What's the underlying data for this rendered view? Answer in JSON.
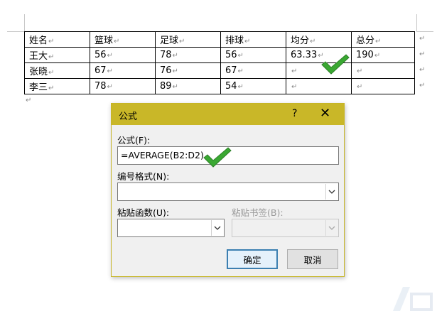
{
  "table": {
    "header": [
      "姓名",
      "篮球",
      "足球",
      "排球",
      "均分",
      "总分"
    ],
    "rows": [
      [
        "王大",
        "56",
        "78",
        "56",
        "63.33",
        "190"
      ],
      [
        "张晓",
        "67",
        "76",
        "67",
        "",
        ""
      ],
      [
        "李三",
        "78",
        "89",
        "54",
        "",
        ""
      ]
    ],
    "cell_mark": "↵"
  },
  "dialog": {
    "title": "公式",
    "help": "?",
    "close": "✕",
    "formula_label": "公式(F):",
    "formula_value": "=AVERAGE(B2:D2)",
    "number_format_label": "编号格式(N):",
    "number_format_value": "",
    "paste_function_label": "粘贴函数(U):",
    "paste_function_value": "",
    "paste_bookmark_label": "粘贴书签(B):",
    "paste_bookmark_value": "",
    "ok_label": "确定",
    "cancel_label": "取消"
  },
  "colors": {
    "titlebar": "#c9b728",
    "check": "#3aa832",
    "default_button_border": "#3c7fb1"
  }
}
